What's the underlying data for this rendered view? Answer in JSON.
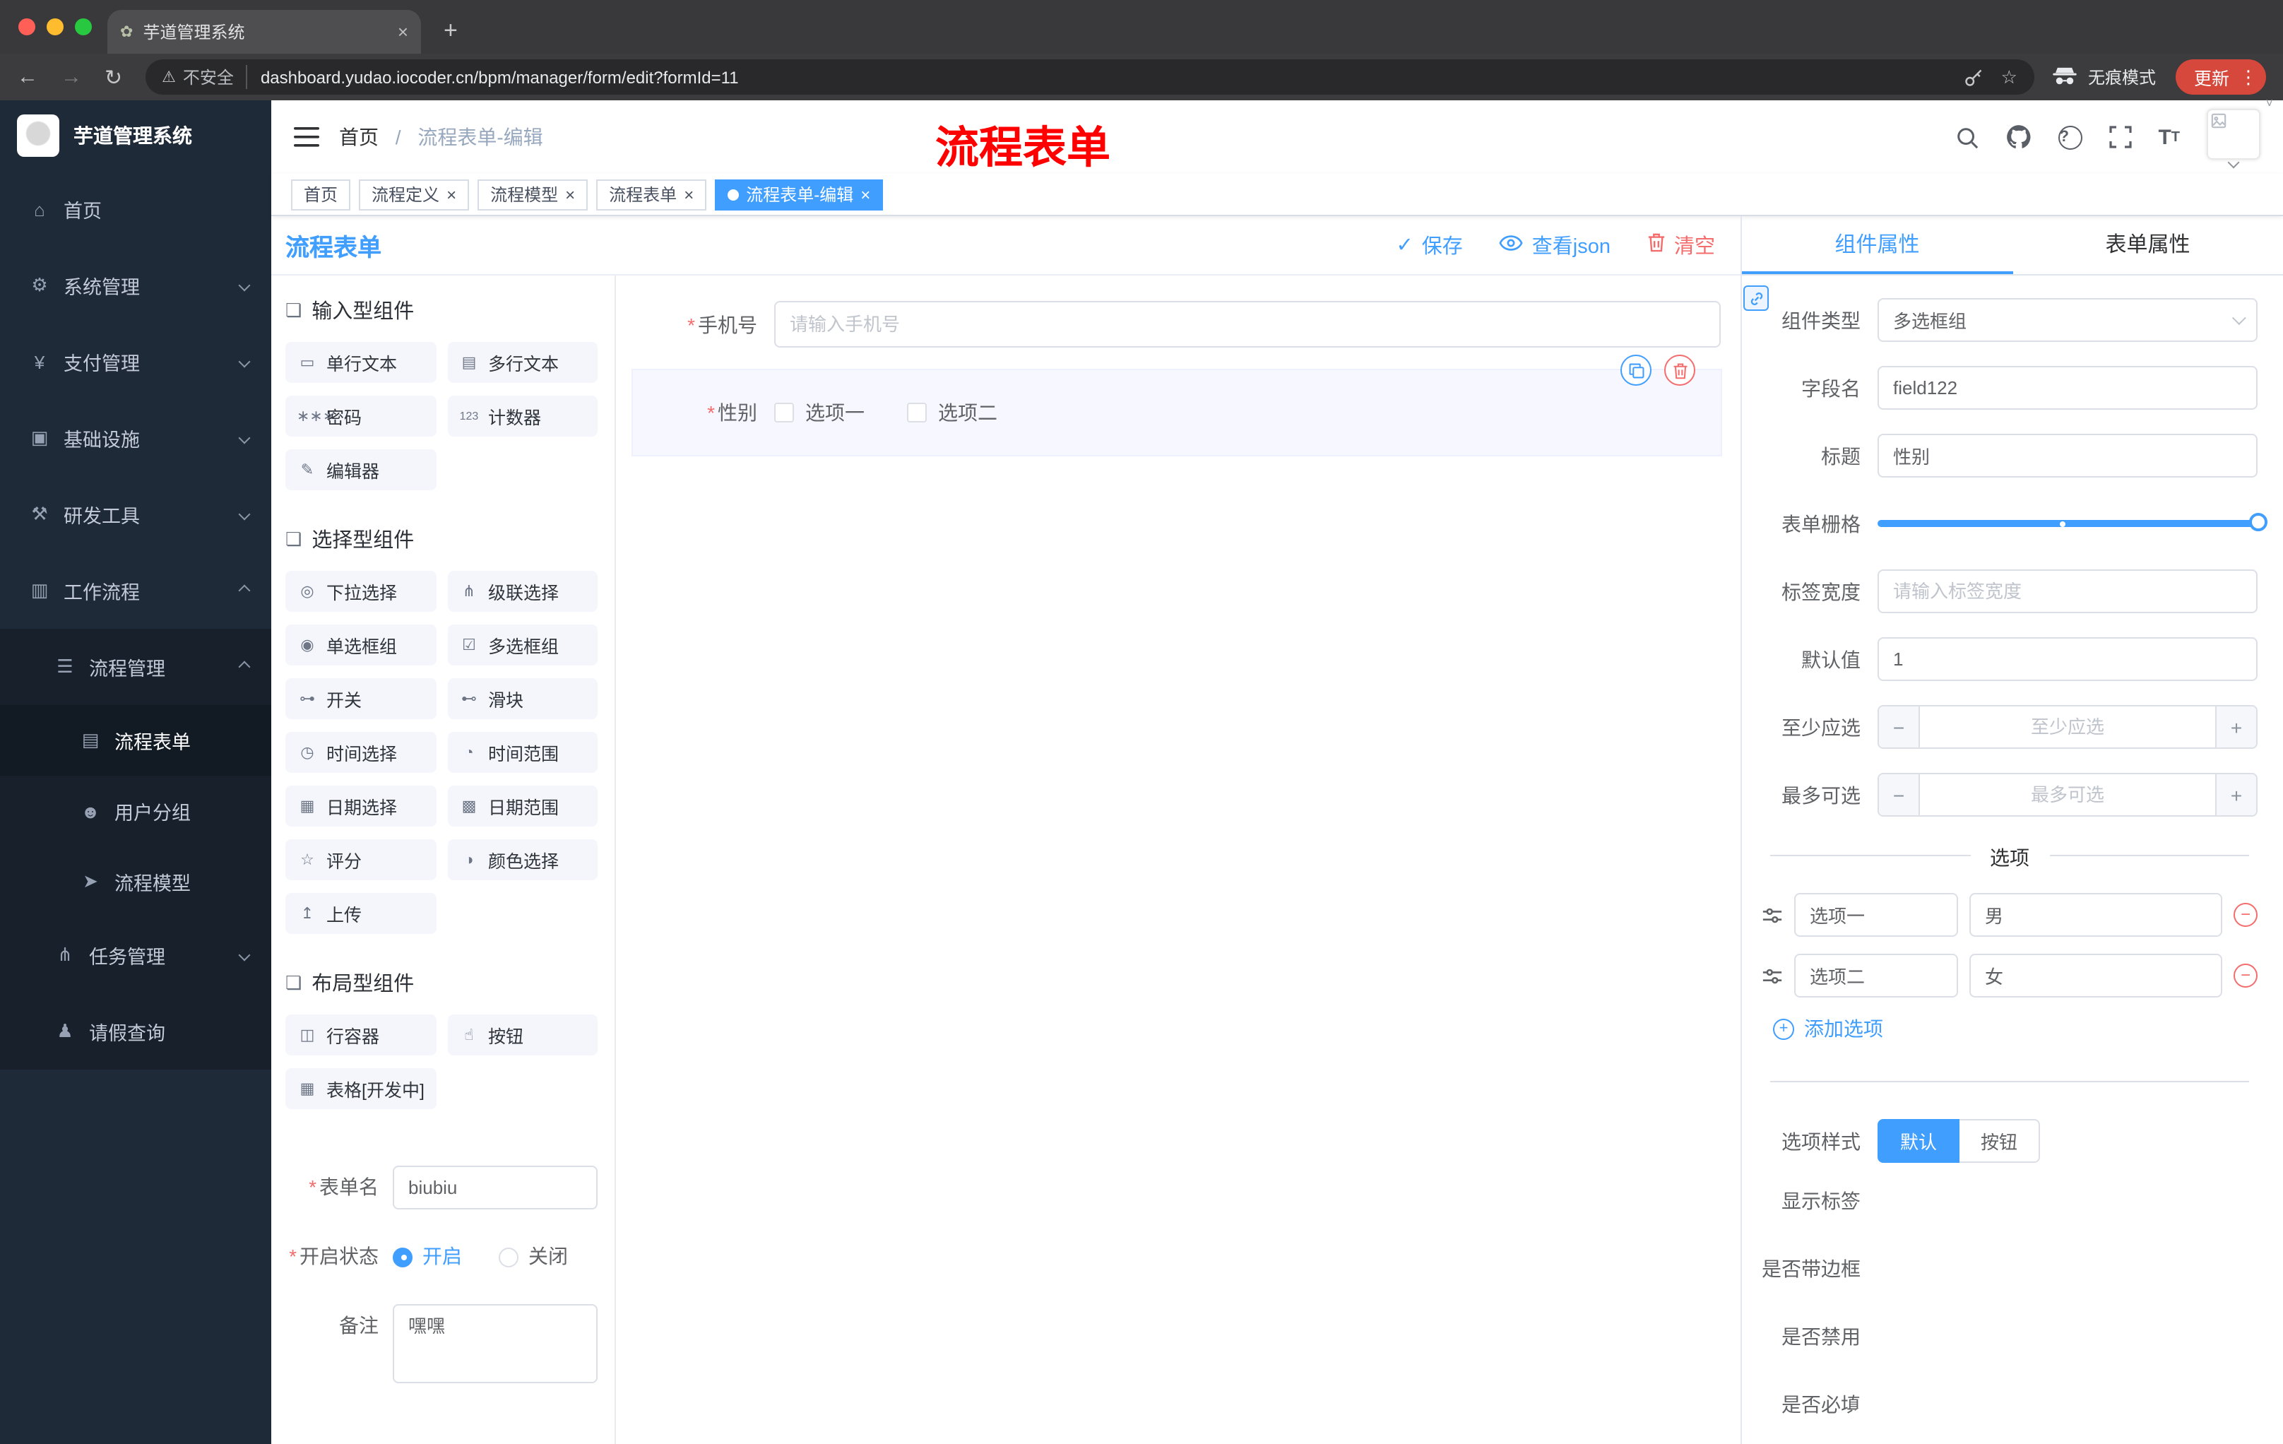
{
  "icons": {
    "close": "×",
    "check": "✓",
    "plus": "+",
    "minus": "−",
    "kebab": "⋮",
    "help": "?",
    "star": "☆",
    "warning": "⚠",
    "back": "←",
    "forward": "→",
    "reload": "↻",
    "font_large": "T",
    "font_small": "T",
    "new_tab": "+",
    "breadcrumb_sep": "/"
  },
  "colors": {
    "accent": "#409eff",
    "danger": "#f56c6c",
    "annotation": "#ff0000",
    "sidebar_bg": "#1f2a38"
  },
  "browser": {
    "tab_title": "芋道管理系统",
    "favicon_glyph": "✿",
    "security_label": "不安全",
    "url": "dashboard.yudao.iocoder.cn/bpm/manager/form/edit?formId=11",
    "incognito_label": "无痕模式",
    "update_label": "更新"
  },
  "sidebar": {
    "logo_title": "芋道管理系统",
    "items": [
      {
        "label": "首页",
        "glyph": "⌂"
      },
      {
        "label": "系统管理",
        "glyph": "⚙"
      },
      {
        "label": "支付管理",
        "glyph": "¥"
      },
      {
        "label": "基础设施",
        "glyph": "▣"
      },
      {
        "label": "研发工具",
        "glyph": "⚒"
      },
      {
        "label": "工作流程",
        "glyph": "▥"
      },
      {
        "label": "流程管理",
        "glyph": "☰"
      },
      {
        "label": "流程表单",
        "glyph": "▤",
        "active": true
      },
      {
        "label": "用户分组",
        "glyph": "☻"
      },
      {
        "label": "流程模型",
        "glyph": "➤"
      },
      {
        "label": "任务管理",
        "glyph": "⋔"
      },
      {
        "label": "请假查询",
        "glyph": "♟"
      }
    ]
  },
  "header": {
    "breadcrumb_home": "首页",
    "breadcrumb_current": "流程表单-编辑",
    "annotation": "流程表单"
  },
  "tags": [
    {
      "label": "首页"
    },
    {
      "label": "流程定义",
      "closable": true
    },
    {
      "label": "流程模型",
      "closable": true
    },
    {
      "label": "流程表单",
      "closable": true
    },
    {
      "label": "流程表单-编辑",
      "closable": true,
      "active": true
    }
  ],
  "designer": {
    "panel_title": "流程表单",
    "actions": {
      "save": "保存",
      "view_json": "查看json",
      "clear": "清空"
    },
    "groups": [
      {
        "title": "输入型组件",
        "items": [
          {
            "label": "单行文本",
            "glyph": "▭"
          },
          {
            "label": "多行文本",
            "glyph": "▤"
          },
          {
            "label": "密码",
            "glyph": "∗∗∗"
          },
          {
            "label": "计数器",
            "glyph": "123"
          },
          {
            "label": "编辑器",
            "glyph": "✎"
          }
        ]
      },
      {
        "title": "选择型组件",
        "items": [
          {
            "label": "下拉选择",
            "glyph": "◎"
          },
          {
            "label": "级联选择",
            "glyph": "⋔"
          },
          {
            "label": "单选框组",
            "glyph": "◉"
          },
          {
            "label": "多选框组",
            "glyph": "☑"
          },
          {
            "label": "开关",
            "glyph": "⊶"
          },
          {
            "label": "滑块",
            "glyph": "⊷"
          },
          {
            "label": "时间选择",
            "glyph": "◷"
          },
          {
            "label": "时间范围",
            "glyph": "◔"
          },
          {
            "label": "日期选择",
            "glyph": "▦"
          },
          {
            "label": "日期范围",
            "glyph": "▩"
          },
          {
            "label": "评分",
            "glyph": "☆"
          },
          {
            "label": "颜色选择",
            "glyph": "◑"
          },
          {
            "label": "上传",
            "glyph": "↥"
          }
        ]
      },
      {
        "title": "布局型组件",
        "items": [
          {
            "label": "行容器",
            "glyph": "◫"
          },
          {
            "label": "按钮",
            "glyph": "☝"
          },
          {
            "label": "表格[开发中]",
            "glyph": "▦"
          }
        ]
      }
    ],
    "meta_form": {
      "name_label": "表单名",
      "name_value": "biubiu",
      "status_label": "开启状态",
      "status_on": "开启",
      "status_off": "关闭",
      "remark_label": "备注",
      "remark_value": "嘿嘿"
    }
  },
  "canvas": {
    "phone": {
      "label": "手机号",
      "placeholder": "请输入手机号"
    },
    "gender": {
      "label": "性别",
      "option1": "选项一",
      "option2": "选项二"
    }
  },
  "props": {
    "tab_component": "组件属性",
    "tab_form": "表单属性",
    "rows": {
      "type_label": "组件类型",
      "type_value": "多选框组",
      "field_label": "字段名",
      "field_value": "field122",
      "title_label": "标题",
      "title_value": "性别",
      "grid_label": "表单栅格",
      "width_label": "标签宽度",
      "width_placeholder": "请输入标签宽度",
      "default_label": "默认值",
      "default_value": "1",
      "min_label": "至少应选",
      "min_placeholder": "至少应选",
      "max_label": "最多可选",
      "max_placeholder": "最多可选"
    },
    "options_divider": "选项",
    "options": [
      {
        "label": "选项一",
        "value": "男"
      },
      {
        "label": "选项二",
        "value": "女"
      }
    ],
    "add_option": "添加选项",
    "style_label": "选项样式",
    "style_default": "默认",
    "style_button": "按钮",
    "switches": [
      {
        "label": "显示标签",
        "on": true
      },
      {
        "label": "是否带边框",
        "on": false
      },
      {
        "label": "是否禁用",
        "on": false
      },
      {
        "label": "是否必填",
        "on": true
      }
    ]
  }
}
